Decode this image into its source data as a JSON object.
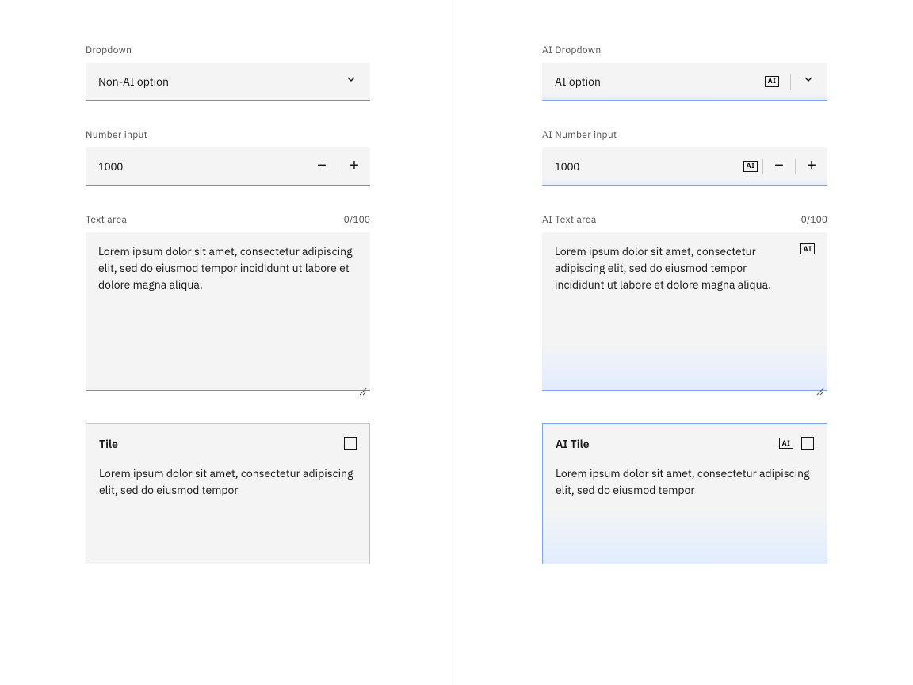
{
  "left": {
    "dropdown": {
      "label": "Dropdown",
      "value": "Non-AI option"
    },
    "number": {
      "label": "Number input",
      "value": "1000"
    },
    "textarea": {
      "label": "Text area",
      "count": "0/100",
      "value": "Lorem ipsum dolor sit amet, consectetur adipiscing elit, sed do eiusmod tempor incididunt ut labore et dolore magna aliqua."
    },
    "tile": {
      "title": "Tile",
      "body": "Lorem ipsum dolor sit amet, consectetur adipiscing elit, sed do eiusmod tempor"
    }
  },
  "right": {
    "dropdown": {
      "label": "AI Dropdown",
      "value": "AI option"
    },
    "number": {
      "label": "AI Number input",
      "value": "1000"
    },
    "textarea": {
      "label": "AI Text area",
      "count": "0/100",
      "value": "Lorem ipsum dolor sit amet, consectetur adipiscing elit, sed do eiusmod tempor incididunt ut labore et dolore magna aliqua."
    },
    "tile": {
      "title": "AI Tile",
      "body": "Lorem ipsum dolor sit amet, consectetur adipiscing elit, sed do eiusmod tempor"
    }
  },
  "ai_badge": "AI"
}
